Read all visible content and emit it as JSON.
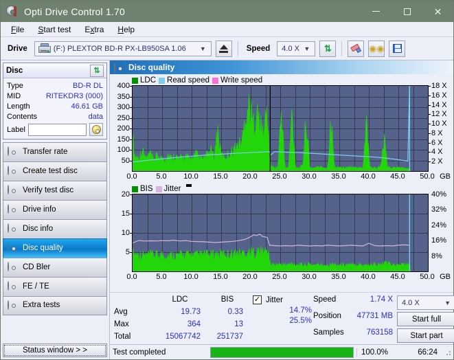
{
  "window": {
    "title": "Opti Drive Control 1.70",
    "icon": "disc-icon",
    "minimize": "minimize-icon",
    "maximize": "maximize-icon",
    "close": "close-icon"
  },
  "menu": {
    "items": [
      "File",
      "Start test",
      "Extra",
      "Help"
    ]
  },
  "toolbar": {
    "drive_label": "Drive",
    "drive_value": "(F:)   PLEXTOR BD-R  PX-LB950SA 1.06",
    "eject_icon": "eject-icon",
    "speed_label": "Speed",
    "speed_value": "4.0 X",
    "refresh_icon": "refresh-icon",
    "erase_icon": "eraser-icon",
    "coin_icon": "coins-icon",
    "save_icon": "save-icon"
  },
  "disc_panel": {
    "title": "Disc",
    "refresh_icon": "refresh-icon",
    "rows": [
      {
        "key": "Type",
        "value": "BD-R DL"
      },
      {
        "key": "MID",
        "value": "RITEKDR3 (000)"
      },
      {
        "key": "Length",
        "value": "46.61 GB"
      },
      {
        "key": "Contents",
        "value": "data"
      }
    ],
    "label_key": "Label",
    "label_value": "",
    "label_button_icon": "disc-label-icon"
  },
  "nav": {
    "items": [
      {
        "label": "Transfer rate",
        "active": false
      },
      {
        "label": "Create test disc",
        "active": false
      },
      {
        "label": "Verify test disc",
        "active": false
      },
      {
        "label": "Drive info",
        "active": false
      },
      {
        "label": "Disc info",
        "active": false
      },
      {
        "label": "Disc quality",
        "active": true
      },
      {
        "label": "CD Bler",
        "active": false
      },
      {
        "label": "FE / TE",
        "active": false
      },
      {
        "label": "Extra tests",
        "active": false
      }
    ],
    "status_button": "Status window > >"
  },
  "main": {
    "header": "Disc quality"
  },
  "stats": {
    "col_headers": [
      "",
      "LDC",
      "BIS"
    ],
    "rows": [
      {
        "label": "Avg",
        "ldc": "19.73",
        "bis": "0.33"
      },
      {
        "label": "Max",
        "ldc": "364",
        "bis": "13"
      },
      {
        "label": "Total",
        "ldc": "15067742",
        "bis": "251737"
      }
    ],
    "jitter_label": "Jitter",
    "jitter_checked": true,
    "jitter_avg": "14.7%",
    "jitter_max": "25.5%",
    "speed_label": "Speed",
    "speed_value": "1.74 X",
    "position_label": "Position",
    "position_value": "47731 MB",
    "samples_label": "Samples",
    "samples_value": "763158",
    "speed_select": "4.0 X",
    "start_full": "Start full",
    "start_part": "Start part"
  },
  "statusbar": {
    "text": "Test completed",
    "percent": "100.0%",
    "percent_fill": 100,
    "time": "66:24"
  },
  "colors": {
    "title_bar": "#6f8270",
    "plot_bg": "#55628c",
    "ldc_green": "#23d60a",
    "bis_green": "#23d60a",
    "read_speed": "#6fd8f5",
    "write_speed": "#ff6fd8",
    "jitter_pink": "#d7b4dd",
    "accent_blue": "#2b2fc0",
    "progress_green": "#17b317"
  },
  "chart_data": [
    {
      "type": "line",
      "name": "disc-quality-ldc-chart",
      "title": "",
      "xlabel": "GB",
      "ylabel": "LDC",
      "xlim": [
        0,
        50
      ],
      "ylim": [
        0,
        400
      ],
      "y2lim": [
        0,
        18
      ],
      "y2label": "X",
      "xticks": [
        "0.0",
        "5.0",
        "10.0",
        "15.0",
        "20.0",
        "25.0",
        "30.0",
        "35.0",
        "40.0",
        "45.0",
        "50.0"
      ],
      "yticks": [
        50,
        100,
        150,
        200,
        250,
        300,
        350,
        400
      ],
      "y2ticks": [
        "2 X",
        "4 X",
        "6 X",
        "8 X",
        "10 X",
        "12 X",
        "14 X",
        "16 X",
        "18 X"
      ],
      "grid": true,
      "legend": [
        {
          "label": "LDC",
          "color": "#009000"
        },
        {
          "label": "Read speed",
          "color": "#7ccdf0"
        },
        {
          "label": "Write speed",
          "color": "#ff6fd8"
        }
      ],
      "series": [
        {
          "name": "LDC",
          "color": "#23d60a",
          "x": [
            0.0,
            0.3,
            0.6,
            0.9,
            1.2,
            1.6,
            2.0,
            2.4,
            2.9,
            3.4,
            3.9,
            4.4,
            4.9,
            5.4,
            6.0,
            6.6,
            7.2,
            7.8,
            8.4,
            9.0,
            9.6,
            10.2,
            10.8,
            11.4,
            12.0,
            12.6,
            13.2,
            13.8,
            14.4,
            15.0,
            15.6,
            16.2,
            16.8,
            17.4,
            18.0,
            18.6,
            19.2,
            19.8,
            20.4,
            21.0,
            21.6,
            22.2,
            22.8,
            23.2,
            23.6,
            24.0,
            24.6,
            25.2,
            25.8,
            26.4,
            27.0,
            27.6,
            28.2,
            28.8,
            29.4,
            30.0,
            30.6,
            31.2,
            31.8,
            32.4,
            33.0,
            33.6,
            34.2,
            34.8,
            35.4,
            36.0,
            36.6,
            37.2,
            37.8,
            38.4,
            39.0,
            39.6,
            40.2,
            40.8,
            41.4,
            42.0,
            42.6,
            43.2,
            43.8,
            44.4,
            45.0,
            45.6,
            46.2,
            46.8
          ],
          "y": [
            205,
            95,
            80,
            75,
            78,
            120,
            85,
            70,
            95,
            72,
            75,
            88,
            70,
            68,
            95,
            72,
            90,
            68,
            75,
            82,
            70,
            72,
            95,
            68,
            70,
            85,
            120,
            75,
            235,
            90,
            78,
            95,
            110,
            130,
            145,
            175,
            340,
            365,
            260,
            330,
            250,
            210,
            360,
            70,
            25,
            20,
            22,
            350,
            18,
            20,
            325,
            22,
            18,
            30,
            300,
            20,
            18,
            22,
            25,
            20,
            18,
            290,
            20,
            25,
            18,
            20,
            22,
            18,
            25,
            20,
            18,
            295,
            22,
            18,
            20,
            25,
            170,
            20,
            18,
            22,
            20,
            18,
            15,
            12
          ]
        },
        {
          "name": "Read speed",
          "color": "#7ccdf0",
          "axis": "y2",
          "x": [
            0.0,
            2.0,
            4.0,
            6.0,
            8.0,
            10.0,
            12.0,
            14.0,
            16.0,
            18.0,
            20.0,
            22.0,
            23.2,
            23.4,
            24.0,
            25.0,
            27.0,
            29.0,
            31.0,
            33.0,
            35.0,
            37.0,
            39.0,
            41.0,
            43.0,
            45.0,
            46.6,
            46.9
          ],
          "y": [
            1.9,
            2.2,
            2.45,
            2.7,
            2.95,
            3.15,
            3.35,
            3.5,
            3.65,
            3.8,
            3.9,
            4.0,
            4.1,
            3.4,
            4.1,
            4.05,
            3.95,
            3.85,
            3.7,
            3.55,
            3.4,
            3.25,
            3.1,
            2.95,
            2.75,
            2.4,
            2.1,
            18.0
          ]
        }
      ],
      "markers": [
        {
          "type": "vline",
          "x": 46.9,
          "color": "#6fd8f5"
        },
        {
          "type": "vline",
          "x": 23.3,
          "color": "#000000"
        }
      ]
    },
    {
      "type": "line",
      "name": "disc-quality-bis-jitter-chart",
      "title": "",
      "xlabel": "GB",
      "ylabel": "BIS",
      "xlim": [
        0,
        50
      ],
      "ylim": [
        0,
        20
      ],
      "y2lim": [
        0,
        40
      ],
      "y2label": "%",
      "xticks": [
        "0.0",
        "5.0",
        "10.0",
        "15.0",
        "20.0",
        "25.0",
        "30.0",
        "35.0",
        "40.0",
        "45.0",
        "50.0"
      ],
      "yticks": [
        5,
        10,
        15,
        20
      ],
      "y2ticks": [
        "8%",
        "16%",
        "24%",
        "32%",
        "40%"
      ],
      "grid": true,
      "legend": [
        {
          "label": "BIS",
          "color": "#009000"
        },
        {
          "label": "Jitter",
          "color": "#d7b4dd"
        }
      ],
      "series": [
        {
          "name": "BIS",
          "color": "#23d60a",
          "x": [
            0,
            1,
            2,
            3,
            4,
            5,
            6,
            7,
            8,
            9,
            10,
            11,
            12,
            13,
            14,
            15,
            16,
            17,
            18,
            19,
            20,
            21,
            22,
            23,
            23.3,
            24,
            25,
            26,
            27,
            28,
            29,
            30,
            31,
            32,
            33,
            34,
            35,
            36,
            37,
            38,
            39,
            40,
            41,
            42,
            43,
            44,
            45,
            46,
            46.8
          ],
          "y": [
            5.9,
            5.2,
            5.0,
            5.1,
            5.0,
            5.2,
            5.0,
            5.1,
            5.0,
            5.2,
            5.1,
            5.0,
            5.2,
            5.1,
            5.3,
            5.4,
            5.4,
            5.6,
            5.6,
            5.8,
            6.0,
            6.1,
            6.2,
            6.3,
            2.3,
            2.1,
            2.2,
            2.0,
            2.4,
            2.1,
            2.0,
            2.2,
            2.0,
            2.1,
            2.0,
            2.2,
            2.0,
            2.1,
            2.0,
            2.2,
            2.1,
            2.0,
            2.2,
            2.0,
            2.6,
            2.1,
            2.0,
            2.2,
            2.0
          ]
        },
        {
          "name": "Jitter",
          "color": "#d7b4dd",
          "axis": "y2",
          "x": [
            0,
            1,
            2,
            3,
            4,
            5,
            6,
            7,
            8,
            9,
            10,
            11,
            12,
            13,
            14,
            15,
            16,
            17,
            18,
            19,
            20,
            20.5,
            21,
            21.5,
            22,
            22.8,
            23.2,
            24,
            25,
            26,
            27,
            28,
            29,
            30,
            31,
            32,
            33,
            34,
            35,
            36,
            37,
            38,
            39,
            40,
            41,
            42,
            43,
            44,
            45,
            46,
            46.8
          ],
          "y": [
            14.8,
            16.0,
            15.8,
            15.9,
            15.8,
            16.0,
            15.9,
            16.2,
            15.8,
            16.0,
            15.6,
            15.5,
            15.4,
            15.2,
            15.0,
            15.2,
            15.4,
            15.6,
            16.0,
            16.6,
            18.0,
            19.0,
            18.6,
            19.4,
            18.2,
            17.6,
            13.6,
            13.4,
            13.2,
            13.4,
            13.2,
            13.6,
            13.4,
            13.2,
            13.4,
            13.2,
            13.6,
            13.4,
            13.2,
            13.4,
            13.6,
            13.4,
            13.2,
            14.6,
            13.4,
            13.2,
            13.4,
            13.2,
            13.6,
            13.8,
            13.6
          ]
        }
      ],
      "markers": [
        {
          "type": "vline",
          "x": 46.9,
          "color": "#6fd8f5"
        }
      ]
    }
  ]
}
